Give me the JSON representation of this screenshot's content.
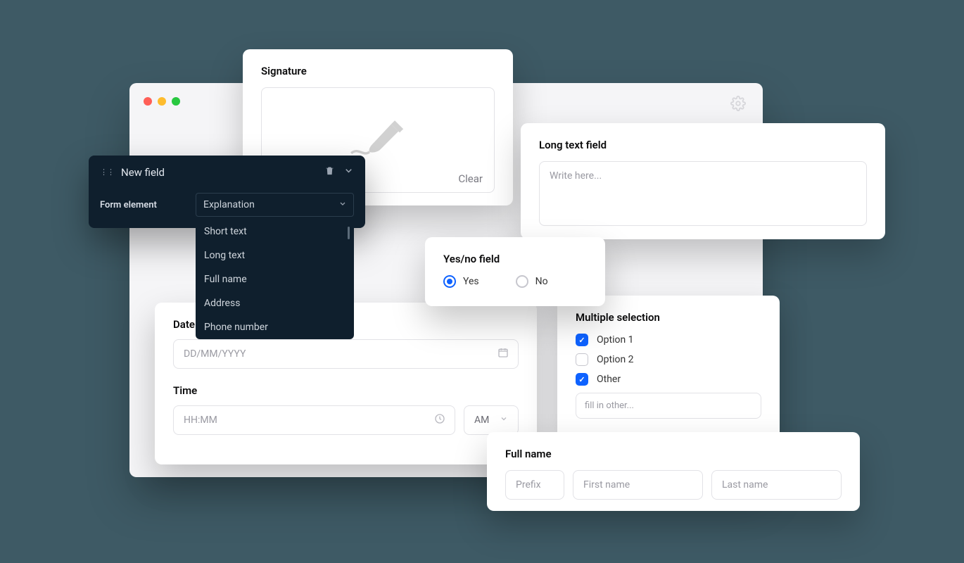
{
  "signature": {
    "title": "Signature",
    "clear": "Clear"
  },
  "newfield": {
    "title": "New field",
    "label": "Form element",
    "selected": "Explanation",
    "options": [
      "Short text",
      "Long text",
      "Full name",
      "Address",
      "Phone number"
    ]
  },
  "date": {
    "title": "Date",
    "placeholder": "DD/MM/YYYY"
  },
  "time": {
    "title": "Time",
    "placeholder": "HH:MM",
    "ampm": "AM"
  },
  "longtext": {
    "title": "Long text field",
    "placeholder": "Write here..."
  },
  "yesno": {
    "title": "Yes/no field",
    "yes": "Yes",
    "no": "No"
  },
  "multi": {
    "title": "Multiple selection",
    "opts": [
      {
        "label": "Option 1",
        "checked": true
      },
      {
        "label": "Option 2",
        "checked": false
      },
      {
        "label": "Other",
        "checked": true
      }
    ],
    "other_placeholder": "fill in other..."
  },
  "fullname": {
    "title": "Full name",
    "prefix": "Prefix",
    "first": "First name",
    "last": "Last name"
  }
}
